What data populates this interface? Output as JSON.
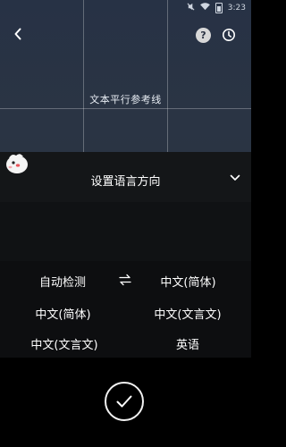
{
  "status_bar": {
    "time": "3:23",
    "icons": [
      "mute-icon",
      "wifi-icon",
      "battery-icon"
    ]
  },
  "camera": {
    "guide_label": "文本平行参考线"
  },
  "toolbar": {
    "back_icon": "chevron-left-icon",
    "help_label": "?",
    "history_icon": "clock-icon"
  },
  "sheet": {
    "title": "设置语言方向",
    "collapse_icon": "chevron-down-icon"
  },
  "languages": {
    "source_selected": "自动检测",
    "swap_icon": "swap-arrows-icon",
    "target_selected": "中文(简体)",
    "options_left": [
      "中文(简体)",
      "中文(文言文)"
    ],
    "options_right": [
      "中文(文言文)",
      "英语"
    ]
  },
  "confirm": {
    "icon": "checkmark-icon"
  },
  "colors": {
    "camera_bg": "#2a3444",
    "sheet_bg": "#141618",
    "panel_bg": "#0d0e10",
    "text": "#ffffff"
  }
}
